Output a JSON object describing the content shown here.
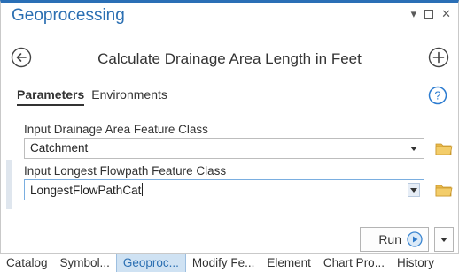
{
  "window": {
    "title": "Geoprocessing",
    "controls": {
      "menu": "▾",
      "restore": "□",
      "close": "✕"
    }
  },
  "header": {
    "tool_title": "Calculate Drainage Area Length in Feet",
    "back_icon": "back-arrow-icon",
    "add_icon": "add-plus-icon"
  },
  "tabs": [
    {
      "label": "Parameters",
      "active": true
    },
    {
      "label": "Environments",
      "active": false
    }
  ],
  "help_icon": "help-icon",
  "parameters": [
    {
      "label": "Input Drainage Area Feature Class",
      "value": "Catchment"
    },
    {
      "label": "Input Longest Flowpath Feature Class",
      "value": "LongestFlowPathCat"
    }
  ],
  "run": {
    "label": "Run"
  },
  "bottom_tabs": [
    {
      "label": "Catalog",
      "active": false
    },
    {
      "label": "Symbol...",
      "active": false
    },
    {
      "label": "Geoproc...",
      "active": true
    },
    {
      "label": "Modify Fe...",
      "active": false
    },
    {
      "label": "Element",
      "active": false
    },
    {
      "label": "Chart Pro...",
      "active": false
    },
    {
      "label": "History",
      "active": false
    }
  ],
  "colors": {
    "accent": "#2b6fb2",
    "folder": "#e8b84a",
    "active_tab_bg": "#cfe2f3"
  }
}
